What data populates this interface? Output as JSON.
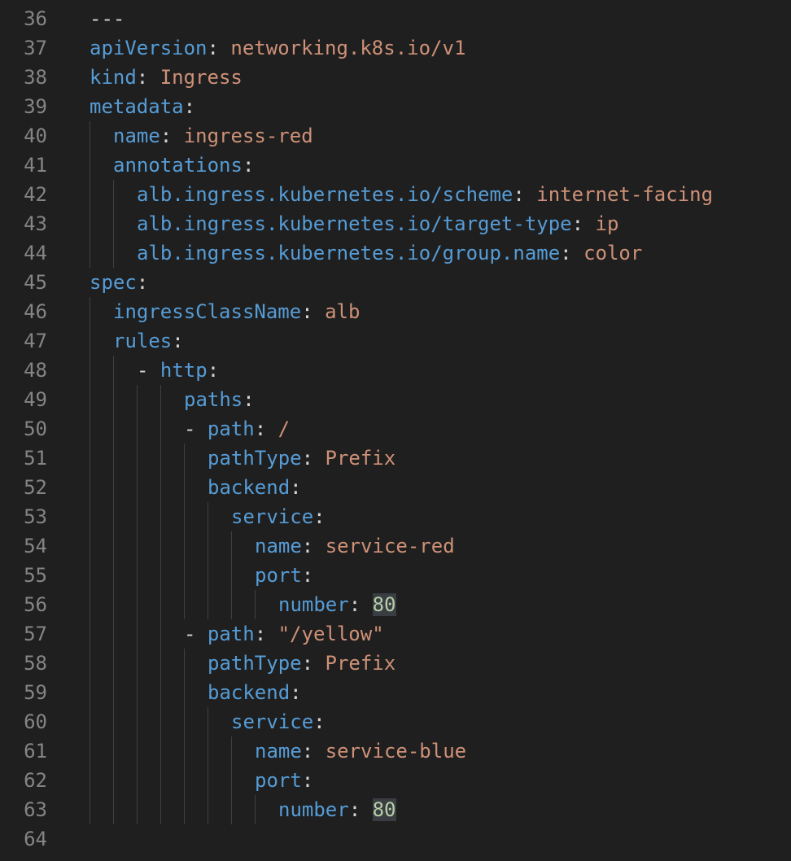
{
  "colors": {
    "background": "#1f1f1f",
    "line_number": "#858585",
    "key": "#569cd6",
    "string_value": "#ce9178",
    "number_value": "#b5cea8",
    "punctuation": "#d4d4d4",
    "indent_guide": "#404040",
    "number_highlight": "#3a3d41"
  },
  "partial_top_line": "- …",
  "lines": [
    {
      "n": "36",
      "indent": 0,
      "tokens": [
        {
          "t": "p",
          "s": "---"
        }
      ]
    },
    {
      "n": "37",
      "indent": 0,
      "tokens": [
        {
          "t": "k",
          "s": "apiVersion"
        },
        {
          "t": "p",
          "s": ": "
        },
        {
          "t": "v",
          "s": "networking.k8s.io/v1"
        }
      ]
    },
    {
      "n": "38",
      "indent": 0,
      "tokens": [
        {
          "t": "k",
          "s": "kind"
        },
        {
          "t": "p",
          "s": ": "
        },
        {
          "t": "v",
          "s": "Ingress"
        }
      ]
    },
    {
      "n": "39",
      "indent": 0,
      "tokens": [
        {
          "t": "k",
          "s": "metadata"
        },
        {
          "t": "p",
          "s": ":"
        }
      ]
    },
    {
      "n": "40",
      "indent": 1,
      "tokens": [
        {
          "t": "k",
          "s": "name"
        },
        {
          "t": "p",
          "s": ": "
        },
        {
          "t": "v",
          "s": "ingress-red"
        }
      ]
    },
    {
      "n": "41",
      "indent": 1,
      "tokens": [
        {
          "t": "k",
          "s": "annotations"
        },
        {
          "t": "p",
          "s": ":"
        }
      ]
    },
    {
      "n": "42",
      "indent": 2,
      "tokens": [
        {
          "t": "k",
          "s": "alb.ingress.kubernetes.io/scheme"
        },
        {
          "t": "p",
          "s": ": "
        },
        {
          "t": "v",
          "s": "internet-facing"
        }
      ]
    },
    {
      "n": "43",
      "indent": 2,
      "tokens": [
        {
          "t": "k",
          "s": "alb.ingress.kubernetes.io/target-type"
        },
        {
          "t": "p",
          "s": ": "
        },
        {
          "t": "v",
          "s": "ip"
        }
      ]
    },
    {
      "n": "44",
      "indent": 2,
      "tokens": [
        {
          "t": "k",
          "s": "alb.ingress.kubernetes.io/group.name"
        },
        {
          "t": "p",
          "s": ": "
        },
        {
          "t": "v",
          "s": "color"
        }
      ]
    },
    {
      "n": "45",
      "indent": 0,
      "tokens": [
        {
          "t": "k",
          "s": "spec"
        },
        {
          "t": "p",
          "s": ":"
        }
      ]
    },
    {
      "n": "46",
      "indent": 1,
      "tokens": [
        {
          "t": "k",
          "s": "ingressClassName"
        },
        {
          "t": "p",
          "s": ": "
        },
        {
          "t": "v",
          "s": "alb"
        }
      ]
    },
    {
      "n": "47",
      "indent": 1,
      "tokens": [
        {
          "t": "k",
          "s": "rules"
        },
        {
          "t": "p",
          "s": ":"
        }
      ]
    },
    {
      "n": "48",
      "indent": 2,
      "tokens": [
        {
          "t": "p",
          "s": "- "
        },
        {
          "t": "k",
          "s": "http"
        },
        {
          "t": "p",
          "s": ":"
        }
      ]
    },
    {
      "n": "49",
      "indent": 4,
      "tokens": [
        {
          "t": "k",
          "s": "paths"
        },
        {
          "t": "p",
          "s": ":"
        }
      ]
    },
    {
      "n": "50",
      "indent": 4,
      "tokens": [
        {
          "t": "p",
          "s": "- "
        },
        {
          "t": "k",
          "s": "path"
        },
        {
          "t": "p",
          "s": ": "
        },
        {
          "t": "v",
          "s": "/"
        }
      ]
    },
    {
      "n": "51",
      "indent": 5,
      "tokens": [
        {
          "t": "k",
          "s": "pathType"
        },
        {
          "t": "p",
          "s": ": "
        },
        {
          "t": "v",
          "s": "Prefix"
        }
      ]
    },
    {
      "n": "52",
      "indent": 5,
      "tokens": [
        {
          "t": "k",
          "s": "backend"
        },
        {
          "t": "p",
          "s": ":"
        }
      ]
    },
    {
      "n": "53",
      "indent": 6,
      "tokens": [
        {
          "t": "k",
          "s": "service"
        },
        {
          "t": "p",
          "s": ":"
        }
      ]
    },
    {
      "n": "54",
      "indent": 7,
      "tokens": [
        {
          "t": "k",
          "s": "name"
        },
        {
          "t": "p",
          "s": ": "
        },
        {
          "t": "v",
          "s": "service-red"
        }
      ]
    },
    {
      "n": "55",
      "indent": 7,
      "tokens": [
        {
          "t": "k",
          "s": "port"
        },
        {
          "t": "p",
          "s": ":"
        }
      ]
    },
    {
      "n": "56",
      "indent": 8,
      "tokens": [
        {
          "t": "k",
          "s": "number"
        },
        {
          "t": "p",
          "s": ": "
        },
        {
          "t": "n",
          "s": "80"
        }
      ]
    },
    {
      "n": "57",
      "indent": 4,
      "tokens": [
        {
          "t": "p",
          "s": "- "
        },
        {
          "t": "k",
          "s": "path"
        },
        {
          "t": "p",
          "s": ": "
        },
        {
          "t": "v",
          "s": "\"/yellow\""
        }
      ]
    },
    {
      "n": "58",
      "indent": 5,
      "tokens": [
        {
          "t": "k",
          "s": "pathType"
        },
        {
          "t": "p",
          "s": ": "
        },
        {
          "t": "v",
          "s": "Prefix"
        }
      ]
    },
    {
      "n": "59",
      "indent": 5,
      "tokens": [
        {
          "t": "k",
          "s": "backend"
        },
        {
          "t": "p",
          "s": ":"
        }
      ]
    },
    {
      "n": "60",
      "indent": 6,
      "tokens": [
        {
          "t": "k",
          "s": "service"
        },
        {
          "t": "p",
          "s": ":"
        }
      ]
    },
    {
      "n": "61",
      "indent": 7,
      "tokens": [
        {
          "t": "k",
          "s": "name"
        },
        {
          "t": "p",
          "s": ": "
        },
        {
          "t": "v",
          "s": "service-blue"
        }
      ]
    },
    {
      "n": "62",
      "indent": 7,
      "tokens": [
        {
          "t": "k",
          "s": "port"
        },
        {
          "t": "p",
          "s": ":"
        }
      ]
    },
    {
      "n": "63",
      "indent": 8,
      "tokens": [
        {
          "t": "k",
          "s": "number"
        },
        {
          "t": "p",
          "s": ": "
        },
        {
          "t": "n",
          "s": "80"
        }
      ]
    },
    {
      "n": "64",
      "indent": 0,
      "tokens": []
    }
  ]
}
